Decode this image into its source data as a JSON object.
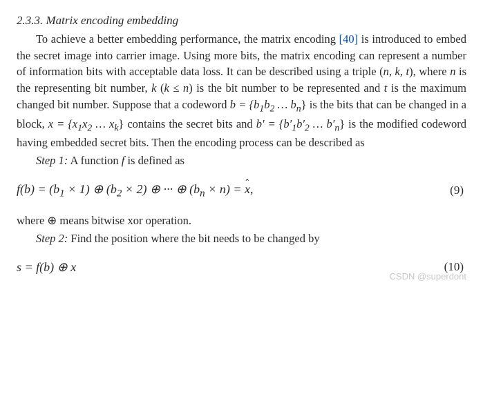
{
  "heading": "2.3.3. Matrix encoding embedding",
  "paragraph": {
    "p1": "To achieve a better embedding performance, the matrix encoding ",
    "cite": "[40]",
    "p2": " is introduced to embed the secret image into carrier image. Using more bits, the matrix encoding can represent a number of information bits with acceptable data loss. It can be described using a triple (",
    "triple1": "n, k, t",
    "p3": "), where ",
    "n": "n",
    "p4": " is the representing bit number, ",
    "k": "k",
    "p5": " (",
    "k2": "k ≤ n",
    "p6": ") is the bit number to be represented and ",
    "t": "t",
    "p7": " is the maximum changed bit number. Suppose that a codeword ",
    "b_eq": "b = {b",
    "sub1": "1",
    "b_mid1": "b",
    "sub2": "2",
    "dots1": " … b",
    "subn": "n",
    "p8": "} is the bits that can be changed in a block, ",
    "x_eq": "x = {x",
    "xs1": "1",
    "x_mid1": "x",
    "xs2": "2",
    "xdots": " … x",
    "xsk": "k",
    "p9": "} contains the secret bits and ",
    "bp_eq": "b′ = {b′",
    "bps1": "1",
    "bp_mid1": "b′",
    "bps2": "2",
    "bpdots": " … b′",
    "bpsn": "n",
    "p10": "} is the modified codeword having embedded secret bits. Then the encoding process can be described as"
  },
  "step1": {
    "label": "Step 1:",
    "text": " A function ",
    "f": "f",
    "text2": " is defined as"
  },
  "eq9": {
    "lhs": "f(b) = (b",
    "s1": "1",
    "m1": " × 1) ⊕ (b",
    "s2": "2",
    "m2": " × 2) ⊕ ··· ⊕ (b",
    "sn": "n",
    "m3": " × n) = ",
    "xhat": "x",
    "comma": ",",
    "num": "(9)"
  },
  "line_xor": {
    "text1": "where ⊕ means bitwise xor operation."
  },
  "step2": {
    "label": "Step 2:",
    "text": " Find the position where the bit needs to be changed by"
  },
  "eq10": {
    "expr": "s = f(b) ⊕ x",
    "num": "(10)"
  },
  "watermark": "CSDN @superdont"
}
